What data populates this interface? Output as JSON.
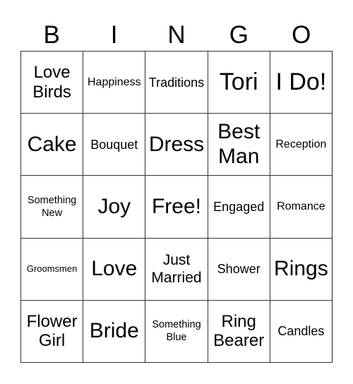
{
  "header": {
    "letters": [
      "B",
      "I",
      "N",
      "G",
      "O"
    ]
  },
  "board": {
    "rows": [
      [
        "Love Birds",
        "Happiness",
        "Traditions",
        "Tori",
        "I Do!"
      ],
      [
        "Cake",
        "Bouquet",
        "Dress",
        "Best Man",
        "Reception"
      ],
      [
        "Something New",
        "Joy",
        "Free!",
        "Engaged",
        "Romance"
      ],
      [
        "Groomsmen",
        "Love",
        "Just Married",
        "Shower",
        "Rings"
      ],
      [
        "Flower Girl",
        "Bride",
        "Something Blue",
        "Ring Bearer",
        "Candles"
      ]
    ],
    "free_space": "Free!"
  }
}
